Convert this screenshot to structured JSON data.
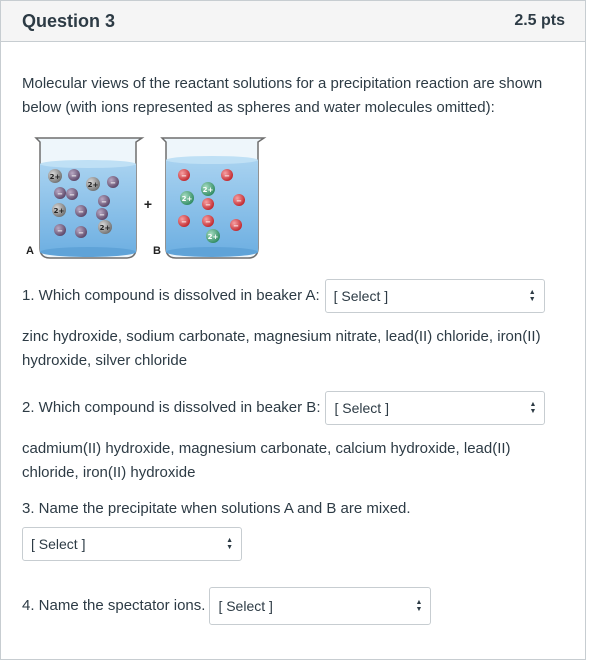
{
  "header": {
    "title": "Question 3",
    "points": "2.5 pts"
  },
  "intro": "Molecular views of the reactant solutions for a precipitation reaction are shown below (with ions represented as spheres and water molecules omitted):",
  "figure": {
    "label_a": "A",
    "label_b": "B",
    "plus": "+",
    "ion_pos_label": "2+",
    "ion_neg_label": "−"
  },
  "questions": [
    {
      "text": "1. Which compound is dissolved in beaker A:",
      "select": "[ Select ]",
      "options": "zinc hydroxide, sodium carbonate, magnesium nitrate, lead(II) chloride, iron(II) hydroxide, silver chloride"
    },
    {
      "text": "2. Which compound is dissolved in beaker B:",
      "select": "[ Select ]",
      "options": "cadmium(II) hydroxide, magnesium carbonate, calcium hydroxide, lead(II) chloride, iron(II) hydroxide"
    },
    {
      "text": "3. Name the precipitate when solutions A and B are mixed.",
      "select": "[ Select ]"
    },
    {
      "text": "4. Name the spectator ions.",
      "select": "[ Select ]"
    }
  ],
  "colors": {
    "header_bg": "#f5f5f5",
    "border": "#c7cdd1",
    "text": "#2d3b45",
    "water": "#8fc3ea",
    "anion_gray": "#7d6b88",
    "anion_red": "#d9343a",
    "cation_gray": "#8e8e8e",
    "cation_green": "#4aa37b"
  }
}
